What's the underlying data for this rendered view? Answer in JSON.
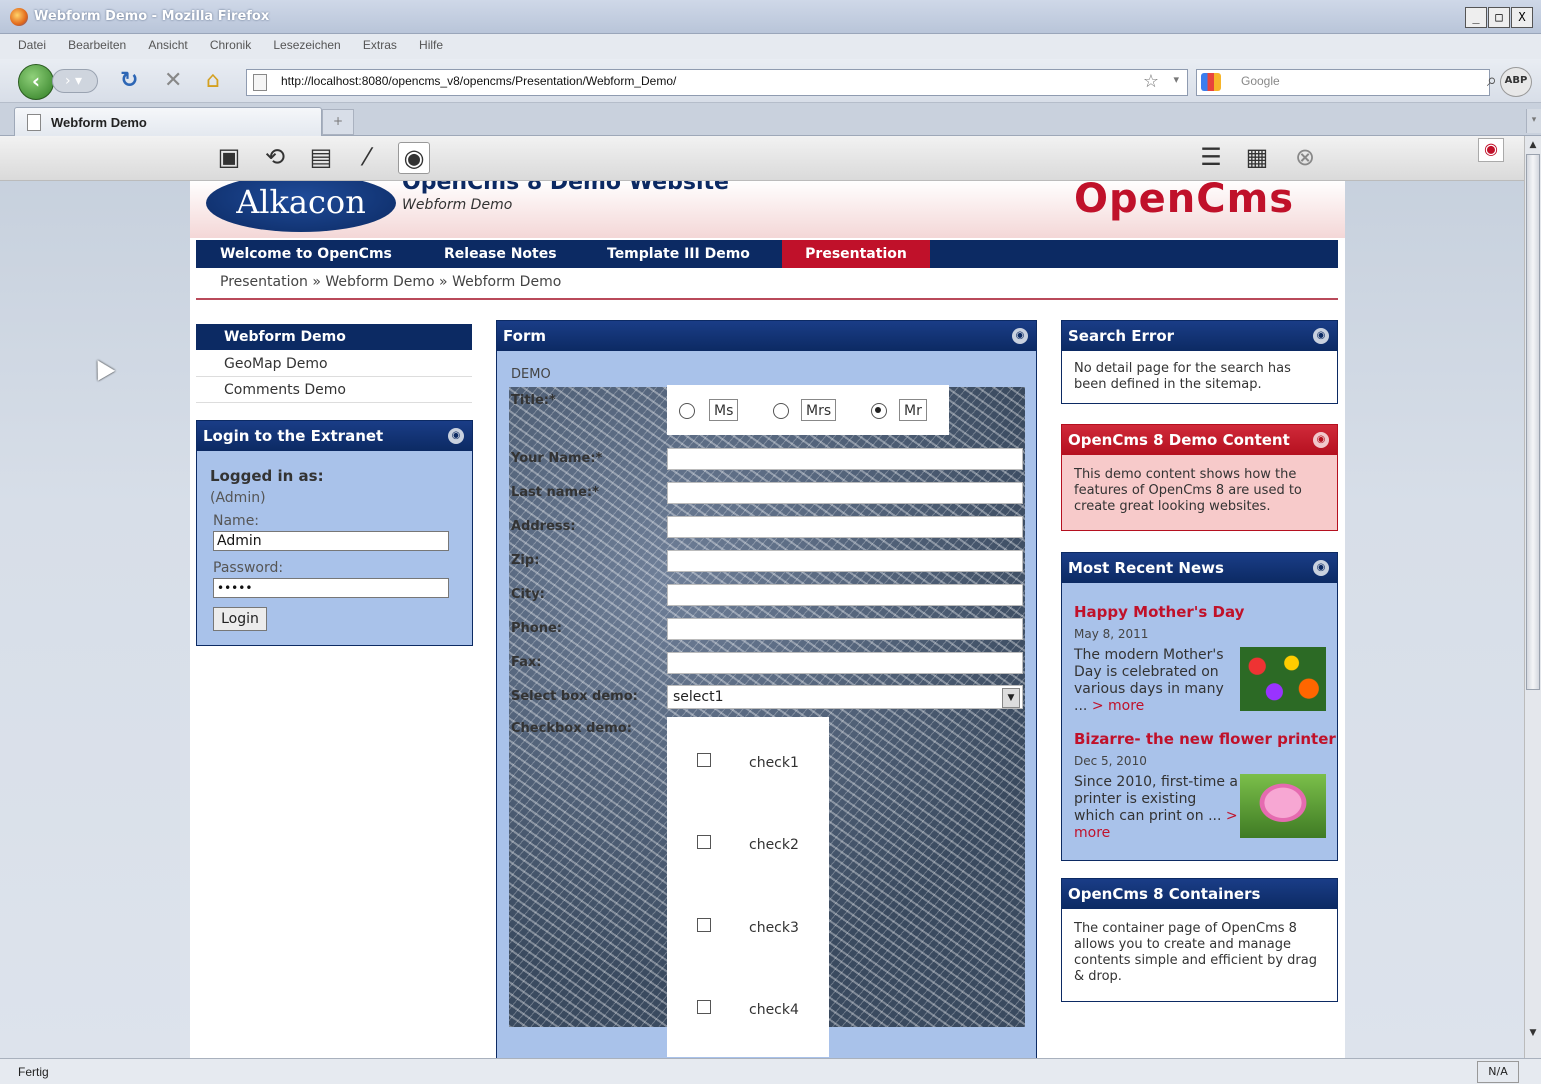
{
  "window": {
    "title": "Webform Demo - Mozilla Firefox",
    "controls": [
      "_",
      "□",
      "X"
    ]
  },
  "menu": [
    "Datei",
    "Bearbeiten",
    "Ansicht",
    "Chronik",
    "Lesezeichen",
    "Extras",
    "Hilfe"
  ],
  "nav": {
    "url": "http://localhost:8080/opencms_v8/opencms/Presentation/Webform_Demo/",
    "search_placeholder": "Google",
    "abp": "ABP"
  },
  "tab": {
    "label": "Webform Demo",
    "new_tab": "+"
  },
  "site": {
    "title": "OpenCms 8 Demo Website",
    "subtitle": "Webform Demo",
    "alkacon_logo": "Alkacon",
    "opencms_logo": "OpenCms"
  },
  "mainnav": [
    "Welcome to OpenCms",
    "Release Notes",
    "Template III Demo",
    "Presentation"
  ],
  "breadcrumb": "Presentation  »  Webform Demo  »  Webform Demo",
  "subnav": [
    "Webform Demo",
    "GeoMap Demo",
    "Comments Demo"
  ],
  "login": {
    "title": "Login to the Extranet",
    "logged_in_label": "Logged in as:",
    "user": "(Admin)",
    "name_label": "Name:",
    "name_value": "Admin",
    "password_label": "Password:",
    "password_value": "•••••",
    "button": "Login"
  },
  "form": {
    "title": "Form",
    "demo_label": "DEMO",
    "title_label": "Title:*",
    "titles": [
      "Ms",
      "Mrs",
      "Mr"
    ],
    "selected_title": "Mr",
    "fields": [
      "Your Name:*",
      "Last name:*",
      "Address:",
      "Zip:",
      "City:",
      "Phone:",
      "Fax:"
    ],
    "select_label": "Select box demo:",
    "select_value": "select1",
    "checkbox_label": "Checkbox demo:",
    "checkboxes": [
      "check1",
      "check2",
      "check3",
      "check4"
    ]
  },
  "right": {
    "search_error": {
      "title": "Search Error",
      "text": "No detail page for the search has been defined in the sitemap."
    },
    "demo_content": {
      "title": "OpenCms 8 Demo Content",
      "text": "This demo content shows how the features of OpenCms 8 are used to create great looking websites."
    },
    "news": {
      "title": "Most Recent News",
      "items": [
        {
          "title": "Happy Mother's Day",
          "date": "May 8, 2011",
          "text": "The modern Mother's Day is celebrated on various days in many ...",
          "more": "> more"
        },
        {
          "title": "Bizarre- the new flower printer",
          "date": "Dec 5, 2010",
          "text": "Since 2010, first-time a printer is existing which can print on ...",
          "more": "> more"
        }
      ]
    },
    "containers": {
      "title": "OpenCms 8 Containers",
      "text": "The container page of OpenCms 8 allows you to create and manage contents simple and efficient by drag & drop."
    }
  },
  "status": {
    "text": "Fertig",
    "na": "N/A"
  }
}
